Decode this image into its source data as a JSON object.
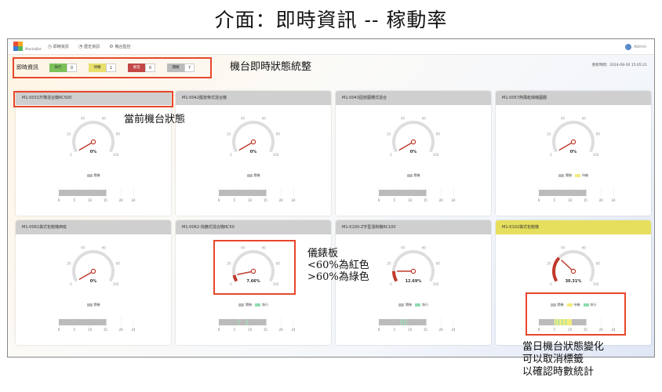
{
  "slide_title": "介面：即時資訊 -- 稼動率",
  "app": {
    "logo_text": "ManHaBot",
    "nav": [
      {
        "label": "即時資訊",
        "icon": "clock-icon"
      },
      {
        "label": "歷史資訊",
        "icon": "history-icon"
      },
      {
        "label": "機台監控",
        "icon": "gear-icon"
      }
    ],
    "user": "Admin",
    "status_label": "即時資訊",
    "status_pills": [
      {
        "name": "執行",
        "count": "0",
        "color": "#7cc15a"
      },
      {
        "name": "待機",
        "count": "1",
        "color": "#e8e06c"
      },
      {
        "name": "異常",
        "count": "0",
        "color": "#c44848"
      },
      {
        "name": "關機",
        "count": "7",
        "color": "#bbbbbb"
      }
    ],
    "updated": "更新時間：2024-08-30 15:05:21"
  },
  "annotations": {
    "status_summary": "機台即時狀態統整",
    "current_state": "當前機台狀態",
    "gauge_note": [
      "儀錶板",
      "<60%為紅色",
      ">60%為綠色"
    ],
    "timeline_note": [
      "當日機台狀態變化",
      "可以取消標籤",
      "以確認時數統計"
    ]
  },
  "legend_labels": {
    "off": "關機",
    "run": "執行",
    "idle": "待機"
  },
  "colors": {
    "off": "#bbbbbb",
    "run": "#8fdcae",
    "idle": "#f3eb7a",
    "needle": "#c0392b",
    "highlight": "#e8472b"
  },
  "gauge_ticks": [
    "0",
    "20",
    "40",
    "60",
    "80",
    "100"
  ],
  "timeline_ticks": [
    "0",
    "5",
    "10",
    "15",
    "20",
    "24"
  ],
  "machines": [
    {
      "name": "M1-0031升降混合機RC500",
      "util": "0%",
      "util_value": 0,
      "header": "gray",
      "legend": [
        "off"
      ],
      "segments": [
        {
          "state": "off",
          "from": 0,
          "to": 15.3
        }
      ]
    },
    {
      "name": "M1-0042擺放帝式混合機",
      "util": "0%",
      "util_value": 0,
      "header": "gray",
      "legend": [
        "off"
      ],
      "segments": [
        {
          "state": "off",
          "from": 0,
          "to": 15.3
        }
      ]
    },
    {
      "name": "M1-0043固放圍攪式混合",
      "util": "0%",
      "util_value": 0,
      "header": "gray",
      "legend": [
        "off"
      ],
      "segments": [
        {
          "state": "off",
          "from": 0,
          "to": 15.3
        }
      ]
    },
    {
      "name": "M1-0057熱風乾燥機圓圈",
      "util": "0%",
      "util_value": 0,
      "header": "gray",
      "legend": [
        "off",
        "idle"
      ],
      "segments": [
        {
          "state": "off",
          "from": 0,
          "to": 15.3
        }
      ]
    },
    {
      "name": "M1-0061袋式包裝機西班",
      "util": "0%",
      "util_value": 0,
      "header": "gray",
      "legend": [
        "off"
      ],
      "segments": [
        {
          "state": "off",
          "from": 0,
          "to": 15.3
        }
      ]
    },
    {
      "name": "M1-0062-快篩式混合機RC50",
      "util": "7.66%",
      "util_value": 7.66,
      "header": "gray",
      "legend": [
        "off",
        "run"
      ],
      "segments": [
        {
          "state": "off",
          "from": 0,
          "to": 6.2
        },
        {
          "state": "run",
          "from": 6.2,
          "to": 6.5
        },
        {
          "state": "off",
          "from": 6.5,
          "to": 8.9
        },
        {
          "state": "run",
          "from": 8.9,
          "to": 9.2
        },
        {
          "state": "off",
          "from": 9.2,
          "to": 15.3
        }
      ]
    },
    {
      "name": "M1-0100-Z字型混和機RC100",
      "util": "12.69%",
      "util_value": 12.69,
      "header": "gray",
      "legend": [
        "off",
        "run"
      ],
      "segments": [
        {
          "state": "off",
          "from": 0,
          "to": 7.0
        },
        {
          "state": "run",
          "from": 7.0,
          "to": 7.3
        },
        {
          "state": "off",
          "from": 7.3,
          "to": 7.8
        },
        {
          "state": "run",
          "from": 7.8,
          "to": 8.1
        },
        {
          "state": "off",
          "from": 8.1,
          "to": 8.6
        },
        {
          "state": "run",
          "from": 8.6,
          "to": 8.9
        },
        {
          "state": "off",
          "from": 8.9,
          "to": 15.3
        }
      ]
    },
    {
      "name": "M1-0102袋式包裝機",
      "util": "30.31%",
      "util_value": 30.31,
      "header": "yellow",
      "legend": [
        "off",
        "idle",
        "run"
      ],
      "segments": [
        {
          "state": "off",
          "from": 0,
          "to": 5.0
        },
        {
          "state": "idle",
          "from": 5.0,
          "to": 5.4
        },
        {
          "state": "run",
          "from": 5.4,
          "to": 5.7
        },
        {
          "state": "idle",
          "from": 5.7,
          "to": 6.3
        },
        {
          "state": "run",
          "from": 6.3,
          "to": 6.6
        },
        {
          "state": "idle",
          "from": 6.6,
          "to": 7.4
        },
        {
          "state": "run",
          "from": 7.4,
          "to": 7.7
        },
        {
          "state": "idle",
          "from": 7.7,
          "to": 8.6
        },
        {
          "state": "run",
          "from": 8.6,
          "to": 8.9
        },
        {
          "state": "idle",
          "from": 8.9,
          "to": 10.6
        },
        {
          "state": "off",
          "from": 10.6,
          "to": 15.3
        }
      ]
    }
  ]
}
